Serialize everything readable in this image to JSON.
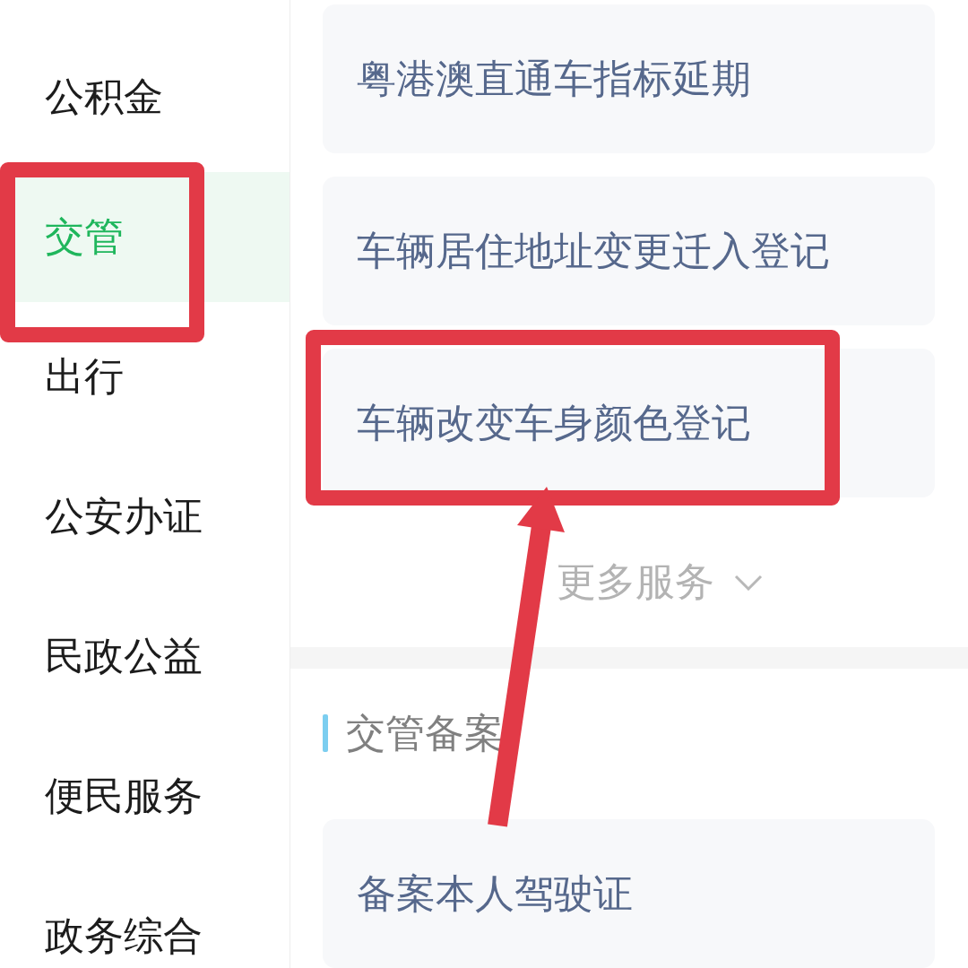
{
  "sidebar": {
    "items": [
      {
        "label": "公积金",
        "selected": false,
        "highlighted": false
      },
      {
        "label": "交管",
        "selected": true,
        "highlighted": true
      },
      {
        "label": "出行",
        "selected": false,
        "highlighted": false
      },
      {
        "label": "公安办证",
        "selected": false,
        "highlighted": false
      },
      {
        "label": "民政公益",
        "selected": false,
        "highlighted": false
      },
      {
        "label": "便民服务",
        "selected": false,
        "highlighted": false
      },
      {
        "label": "政务综合",
        "selected": false,
        "highlighted": false
      }
    ]
  },
  "services": {
    "cards": [
      {
        "label": "粤港澳直通车指标延期",
        "highlighted": false,
        "arrow": false
      },
      {
        "label": "车辆居住地址变更迁入登记",
        "highlighted": false,
        "arrow": false
      },
      {
        "label": "车辆改变车身颜色登记",
        "highlighted": true,
        "arrow": true
      }
    ],
    "more_button": {
      "label": "更多服务"
    }
  },
  "sections": [
    {
      "title": "交管备案",
      "cards": [
        {
          "label": "备案本人驾驶证"
        }
      ]
    }
  ]
}
